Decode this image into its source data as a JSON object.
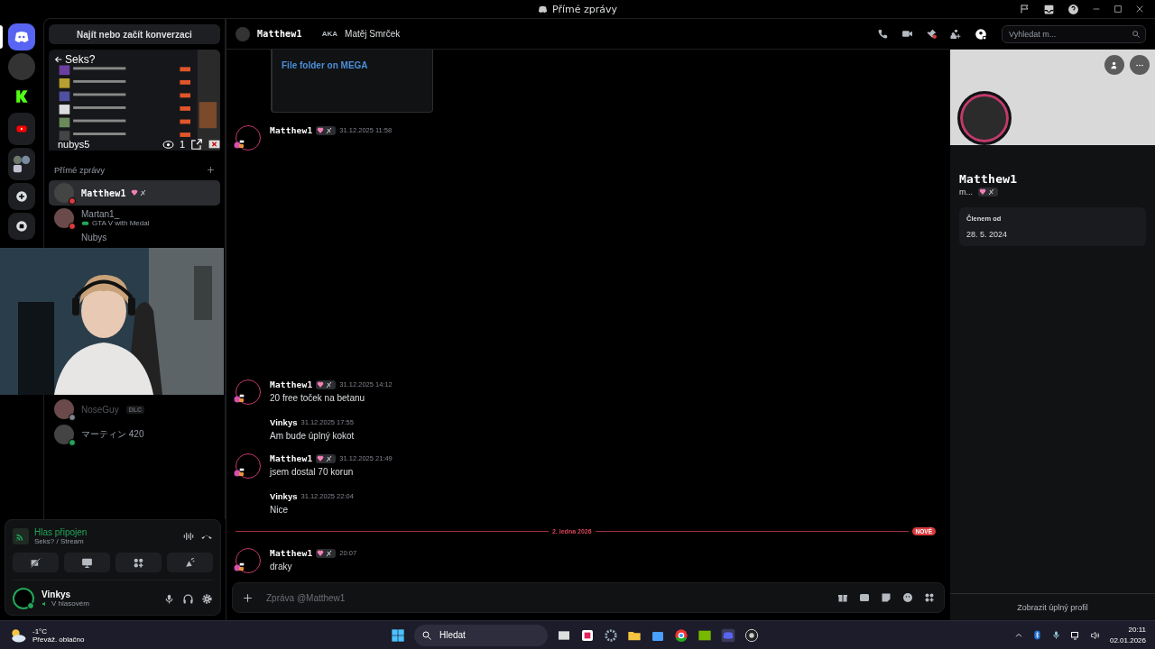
{
  "window": {
    "title": "Přímé zprávy"
  },
  "sidebar": {
    "search": "Najít nebo začít konverzaci",
    "stream_preview": {
      "title": "Seks?",
      "streamer": "nubys5",
      "viewers": "1"
    },
    "dm_header": "Přímé zprávy",
    "dms": [
      {
        "name": "Matthew1",
        "badge": true,
        "color": "#d83c3e",
        "selected": true
      },
      {
        "name": "Martan1_",
        "activity": "GTA V with Medal",
        "color": "#d83c3e",
        "selected": false
      },
      {
        "name": "Nubys",
        "selected": false,
        "kind": "partial"
      },
      {
        "name": "NoseGuy",
        "tag": "DLC",
        "color": "#80848e",
        "selected": false,
        "kind": "faded"
      },
      {
        "name": "マーティン 420",
        "color": "#23a55a",
        "selected": false
      }
    ]
  },
  "voice": {
    "title": "Hlas připojen",
    "channel": "Seks? / Stream"
  },
  "user": {
    "name": "Vinkys",
    "status": "V hlasovém"
  },
  "chat": {
    "name": "Matthew1",
    "aka": "AKA",
    "real_name": "Matěj Smrček",
    "search": {
      "placeholder": "Vyhledat m..."
    },
    "embed_link": "File folder on MEGA",
    "messages": [
      {
        "author": "Matthew1",
        "badge": true,
        "time": "31.12.2025 11:58",
        "avatar": true,
        "kind": "gap"
      },
      {
        "author": "Matthew1",
        "badge": true,
        "time": "31.12.2025 14:12",
        "text": "20 free toček na betanu",
        "avatar": true
      },
      {
        "author": "Vinkys",
        "badge": false,
        "time": "31.12.2025 17:55",
        "text": "Am bude úplný kokot",
        "avatar": false
      },
      {
        "author": "Matthew1",
        "badge": true,
        "time": "31.12.2025 21:49",
        "text": "jsem dostal 70 korun",
        "avatar": true
      },
      {
        "author": "Vinkys",
        "badge": false,
        "time": "31.12.2025 22:04",
        "text": "Nice",
        "avatar": false
      },
      {
        "kind": "divider",
        "date": "2. ledna 2026",
        "badge": "NOVÉ"
      },
      {
        "author": "Matthew1",
        "badge": true,
        "time": "20:07",
        "text": "draky",
        "avatar": true
      }
    ],
    "input": {
      "placeholder": "Zpráva @Matthew1"
    }
  },
  "profile": {
    "name": "Matthew1",
    "handle": "m...",
    "member_label": "Členem od",
    "member_since": "28. 5. 2024",
    "footer": "Zobrazit úplný profil"
  },
  "taskbar": {
    "temp": "-1°C",
    "weather": "Převáž. oblačno",
    "search": "Hledat",
    "time": "20:11",
    "date": "02.01.2026"
  }
}
